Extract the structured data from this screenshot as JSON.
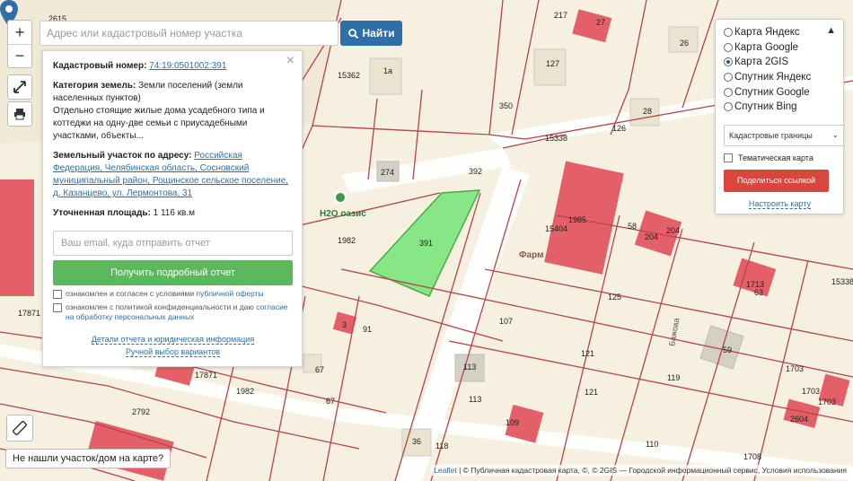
{
  "search": {
    "placeholder": "Адрес или кадастровый номер участка",
    "button_label": "Найти"
  },
  "zoom": {
    "in": "+",
    "out": "−"
  },
  "info_panel": {
    "cadastral_label": "Кадастровый номер:",
    "cadastral_value": "74:19:0501002:391",
    "category_label": "Категория земель:",
    "category_value": "Земли поселений (земли населенных пунктов)",
    "usage_text": "Отдельно стоящие жилые дома усадебного типа и коттеджи на одну-две семьи с приусадебными участками, объекты...",
    "address_label": "Земельный участок по адресу:",
    "address_value": "Российская Федерация, Челябинская область, Сосновский муниципальный район, Рощинское сельское поселение, д. Казанцево, ул. Лермонтова, 31",
    "area_label": "Уточненная площадь:",
    "area_value": "1 116 кв.м",
    "email_placeholder": "Ваш email, куда отправить отчет",
    "report_button": "Получить подробный отчет",
    "agree1_text": "ознакомлен и согласен с условиями ",
    "agree1_link": "публичной оферты",
    "agree2_text": "ознакомлен с политикой конфиденциальности и даю ",
    "agree2_link": "согласие на обработку персональных данных",
    "link_details": "Детали отчета и юридическая информация",
    "link_manual": "Ручной выбор вариантов",
    "close_label": "×"
  },
  "layers": {
    "options": [
      {
        "label": "Карта Яндекс",
        "selected": false
      },
      {
        "label": "Карта Google",
        "selected": false
      },
      {
        "label": "Карта 2GIS",
        "selected": true
      },
      {
        "label": "Спутник Яндекс",
        "selected": false
      },
      {
        "label": "Спутник Google",
        "selected": false
      },
      {
        "label": "Спутник Bing",
        "selected": false
      }
    ],
    "select_value": "Кадастровые границы",
    "thematic_label": "Тематическая карта",
    "share_button": "Поделиться ссылкой",
    "setup_link": "Настроить карту"
  },
  "map": {
    "poi_label": "H2O оазис",
    "farm_label": "Фарм",
    "street_label": "Бажова",
    "labels": [
      "2615",
      "217",
      "26",
      "15362",
      "1а",
      "127",
      "28",
      "350",
      "15338",
      "392",
      "274",
      "1985",
      "15404",
      "58",
      "204",
      "204",
      "391",
      "1982",
      "3",
      "17871",
      "91",
      "107",
      "125",
      "121",
      "121",
      "113",
      "113",
      "67",
      "67",
      "2792",
      "1982",
      "17871",
      "36",
      "118",
      "109",
      "1713",
      "63",
      "59",
      "1703",
      "1703",
      "15338",
      "1708",
      "119",
      "110",
      "2604",
      "1703",
      "126",
      "27"
    ]
  },
  "not_found": "Не нашли участок/дом на карте?",
  "attribution": {
    "leaflet": "Leaflet",
    "rest": " | © Публичная кадастровая карта, ©, © 2GIS — Городской информационный сервис, Условия использования"
  },
  "colors": {
    "parcel_selected": "#7ee67e",
    "building": "#e36068",
    "boundary": "#b8434b",
    "accent_blue": "#2f6fa8",
    "report_green": "#5cb85c",
    "share_red": "#d9463e"
  }
}
